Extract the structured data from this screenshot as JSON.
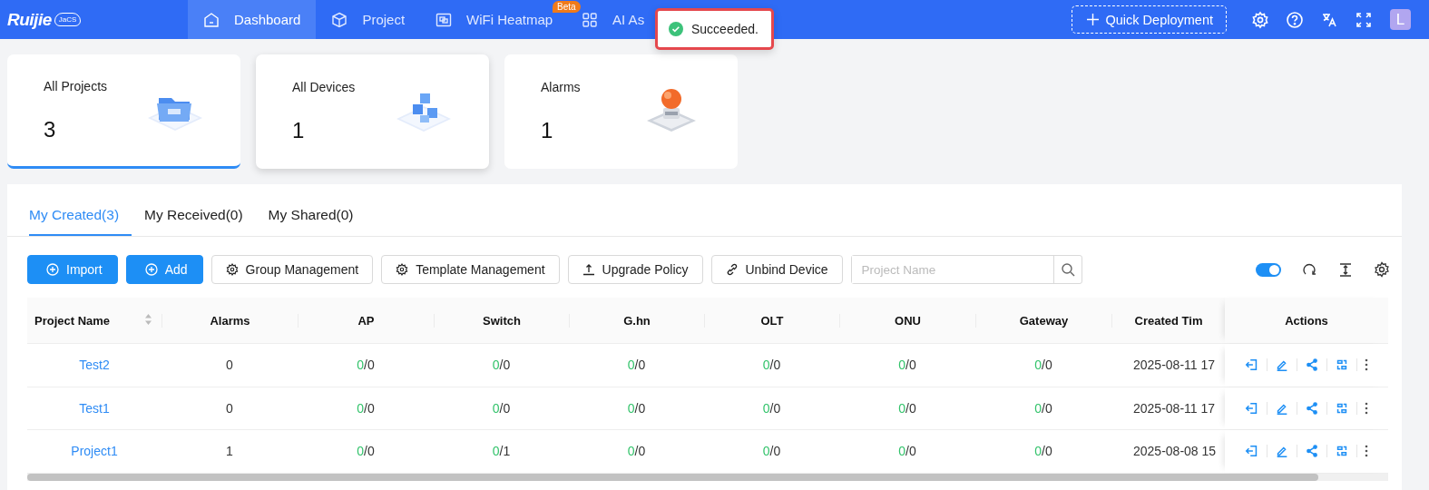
{
  "header": {
    "logo": "Ruijie",
    "logo_badge": "JaCS",
    "nav": [
      {
        "label": "Dashboard",
        "selected": true
      },
      {
        "label": "Project",
        "selected": false
      },
      {
        "label": "WiFi Heatmap",
        "selected": false,
        "badge": "Beta"
      },
      {
        "label": "AI As",
        "selected": false
      }
    ],
    "quick_deployment": "Quick Deployment",
    "avatar": "L"
  },
  "toast": {
    "message": "Succeeded."
  },
  "stats": [
    {
      "label": "All Projects",
      "value": "3",
      "kind": "folder",
      "selected": true
    },
    {
      "label": "All Devices",
      "value": "1",
      "kind": "cubes",
      "selected": false
    },
    {
      "label": "Alarms",
      "value": "1",
      "kind": "alarm",
      "selected": false
    }
  ],
  "tabs": [
    {
      "label": "My Created(3)",
      "selected": true
    },
    {
      "label": "My Received(0)",
      "selected": false
    },
    {
      "label": "My Shared(0)",
      "selected": false
    }
  ],
  "toolbar": {
    "buttons": [
      {
        "label": "Import",
        "kind": "import"
      },
      {
        "label": "Add",
        "kind": "add"
      },
      {
        "label": "Group Management",
        "kind": "group"
      },
      {
        "label": "Template Management",
        "kind": "template"
      },
      {
        "label": "Upgrade Policy",
        "kind": "upgrade"
      },
      {
        "label": "Unbind Device",
        "kind": "unbind"
      }
    ],
    "search": {
      "placeholder": "Project Name"
    },
    "toggle_on": true
  },
  "table": {
    "columns": [
      "Project Name",
      "Alarms",
      "AP",
      "Switch",
      "G.hn",
      "OLT",
      "ONU",
      "Gateway",
      "Created Tim",
      "Actions"
    ],
    "rows": [
      {
        "name": "Test2",
        "alarms": "0",
        "counts": [
          "0/0",
          "0/0",
          "0/0",
          "0/0",
          "0/0",
          "0/0"
        ],
        "created": "2025-08-11 17"
      },
      {
        "name": "Test1",
        "alarms": "0",
        "counts": [
          "0/0",
          "0/0",
          "0/0",
          "0/0",
          "0/0",
          "0/0"
        ],
        "created": "2025-08-11 17"
      },
      {
        "name": "Project1",
        "alarms": "1",
        "counts": [
          "0/0",
          "0/1",
          "0/0",
          "0/0",
          "0/0",
          "0/0"
        ],
        "created": "2025-08-08 15"
      }
    ]
  }
}
